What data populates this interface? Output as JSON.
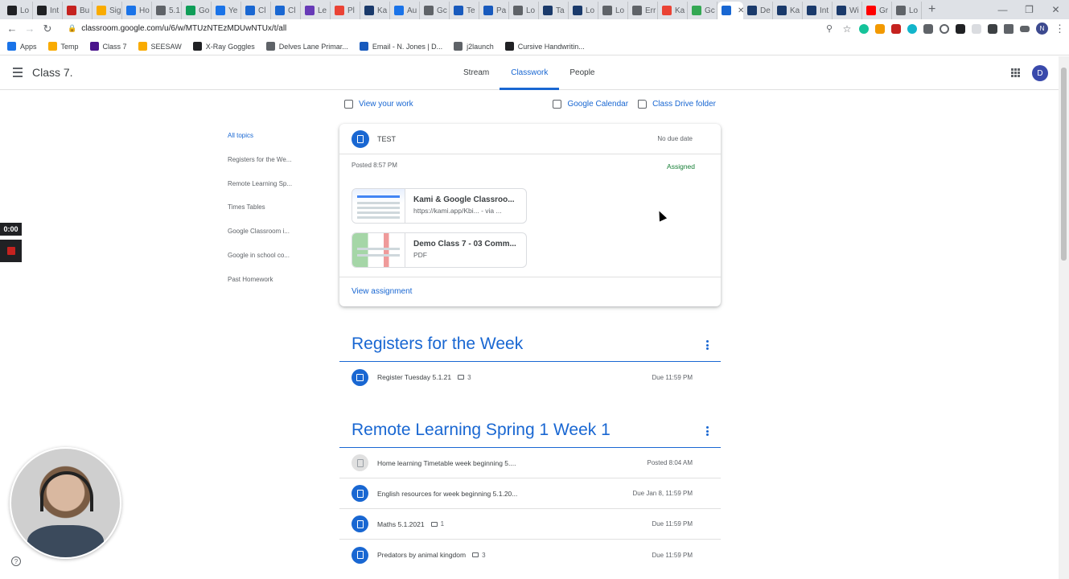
{
  "browser": {
    "tabs": [
      {
        "label": "Lo",
        "color": "#202124"
      },
      {
        "label": "Int",
        "color": "#202124"
      },
      {
        "label": "Bu",
        "color": "#c5221f"
      },
      {
        "label": "Sig",
        "color": "#f9ab00"
      },
      {
        "label": "Ho",
        "color": "#1a73e8"
      },
      {
        "label": "5.1",
        "color": "#5f6368"
      },
      {
        "label": "Go",
        "color": "#0f9d58"
      },
      {
        "label": "Ye",
        "color": "#1a73e8"
      },
      {
        "label": "Cl",
        "color": "#1967d2"
      },
      {
        "label": "Cl",
        "color": "#1967d2"
      },
      {
        "label": "Le",
        "color": "#673ab7"
      },
      {
        "label": "Pl",
        "color": "#ea4335"
      },
      {
        "label": "Ka",
        "color": "#1a3a6b"
      },
      {
        "label": "Au",
        "color": "#1a73e8"
      },
      {
        "label": "Gc",
        "color": "#5f6368"
      },
      {
        "label": "Te",
        "color": "#185abd"
      },
      {
        "label": "Pa",
        "color": "#185abd"
      },
      {
        "label": "Lo",
        "color": "#5f6368"
      },
      {
        "label": "Ta",
        "color": "#1a3a6b"
      },
      {
        "label": "Lo",
        "color": "#1a3a6b"
      },
      {
        "label": "Lo",
        "color": "#5f6368"
      },
      {
        "label": "Err",
        "color": "#5f6368"
      },
      {
        "label": "Ka",
        "color": "#ea4335"
      },
      {
        "label": "Gc",
        "color": "#34a853"
      }
    ],
    "active_tab": {
      "label": "",
      "color": "#1967d2"
    },
    "tabs_after": [
      {
        "label": "De",
        "color": "#1a3a6b"
      },
      {
        "label": "Ka",
        "color": "#1a3a6b"
      },
      {
        "label": "Int",
        "color": "#1a3a6b"
      },
      {
        "label": "Wi",
        "color": "#1a3a6b"
      },
      {
        "label": "Gr",
        "color": "#ff0000"
      },
      {
        "label": "Lo",
        "color": "#5f6368"
      }
    ],
    "url": "classroom.google.com/u/6/w/MTUzNTEzMDUwNTUx/t/all",
    "profile_initial": "N",
    "bookmarks": [
      {
        "label": "Apps",
        "color": "#1a73e8"
      },
      {
        "label": "Temp",
        "color": "#f9ab00"
      },
      {
        "label": "Class 7",
        "color": "#4a148c"
      },
      {
        "label": "SEESAW",
        "color": "#f9ab00"
      },
      {
        "label": "X-Ray Goggles",
        "color": "#202124"
      },
      {
        "label": "Delves Lane Primar...",
        "color": "#5f6368"
      },
      {
        "label": "Email - N. Jones | D...",
        "color": "#185abd"
      },
      {
        "label": "j2launch",
        "color": "#5f6368"
      },
      {
        "label": "Cursive Handwritin...",
        "color": "#202124"
      }
    ]
  },
  "classroom": {
    "class_name": "Class 7.",
    "tabs": [
      "Stream",
      "Classwork",
      "People"
    ],
    "user_initial": "D",
    "view_your_work": "View your work",
    "google_calendar": "Google Calendar",
    "class_drive_folder": "Class Drive folder",
    "topics": [
      "All topics",
      "Registers for the We...",
      "Remote Learning Sp...",
      "Times Tables",
      "Google Classroom i...",
      "Google in school co...",
      "Past Homework"
    ],
    "expanded": {
      "title": "TEST",
      "due": "No due date",
      "posted": "Posted 8:57 PM",
      "status": "Assigned",
      "attachments": [
        {
          "title": "Kami & Google Classroo...",
          "sub": "https://kami.app/Kbi...   - via ..."
        },
        {
          "title": "Demo Class 7 - 03 Comm...",
          "sub": "PDF"
        }
      ],
      "view_assignment": "View assignment"
    },
    "sections": [
      {
        "title": "Registers for the Week",
        "items": [
          {
            "title": "Register Tuesday 5.1.21",
            "comments": "3",
            "due": "Due 11:59 PM",
            "icon": "quiz"
          }
        ]
      },
      {
        "title": "Remote Learning Spring 1 Week 1",
        "items": [
          {
            "title": "Home learning Timetable week beginning 5....",
            "comments": "",
            "due": "Posted 8:04 AM",
            "icon": "material"
          },
          {
            "title": "English resources for week beginning 5.1.20...",
            "comments": "",
            "due": "Due Jan 8, 11:59 PM",
            "icon": "assignment"
          },
          {
            "title": "Maths 5.1.2021",
            "comments": "1",
            "due": "Due 11:59 PM",
            "icon": "assignment"
          },
          {
            "title": "Predators by animal kingdom",
            "comments": "3",
            "due": "Due 11:59 PM",
            "icon": "assignment"
          }
        ]
      }
    ]
  },
  "overlay": {
    "timer": "0:00",
    "help": "?"
  }
}
